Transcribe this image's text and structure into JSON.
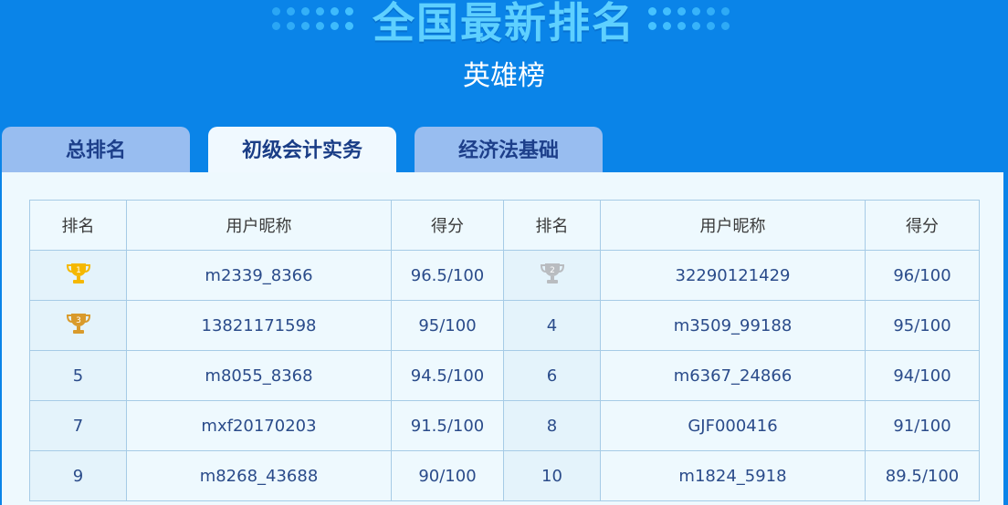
{
  "header": {
    "headline": "全国最新排名",
    "subtitle": "英雄榜"
  },
  "tabs": [
    {
      "label": "总排名",
      "active": false
    },
    {
      "label": "初级会计实务",
      "active": true
    },
    {
      "label": "经济法基础",
      "active": false
    }
  ],
  "table": {
    "columns": [
      "排名",
      "用户昵称",
      "得分",
      "排名",
      "用户昵称",
      "得分"
    ],
    "rows": [
      [
        {
          "rank": "1",
          "icon": "gold-trophy-icon",
          "name": "m2339_8366",
          "score": "96.5/100"
        },
        {
          "rank": "2",
          "icon": "silver-trophy-icon",
          "name": "32290121429",
          "score": "96/100"
        }
      ],
      [
        {
          "rank": "3",
          "icon": "bronze-trophy-icon",
          "name": "13821171598",
          "score": "95/100"
        },
        {
          "rank": "4",
          "icon": "",
          "name": "m3509_99188",
          "score": "95/100"
        }
      ],
      [
        {
          "rank": "5",
          "icon": "",
          "name": "m8055_8368",
          "score": "94.5/100"
        },
        {
          "rank": "6",
          "icon": "",
          "name": "m6367_24866",
          "score": "94/100"
        }
      ],
      [
        {
          "rank": "7",
          "icon": "",
          "name": "mxf20170203",
          "score": "91.5/100"
        },
        {
          "rank": "8",
          "icon": "",
          "name": "GJF000416",
          "score": "91/100"
        }
      ],
      [
        {
          "rank": "9",
          "icon": "",
          "name": "m8268_43688",
          "score": "90/100"
        },
        {
          "rank": "10",
          "icon": "",
          "name": "m1824_5918",
          "score": "89.5/100"
        }
      ]
    ]
  },
  "colors": {
    "background": "#0a84e8",
    "headline": "#5ed0ff",
    "tab_inactive": "#98bdf0",
    "tab_active": "#f0f9ff",
    "gold": "#f5b800",
    "silver": "#b9bcc0",
    "bronze": "#d99a2b"
  }
}
